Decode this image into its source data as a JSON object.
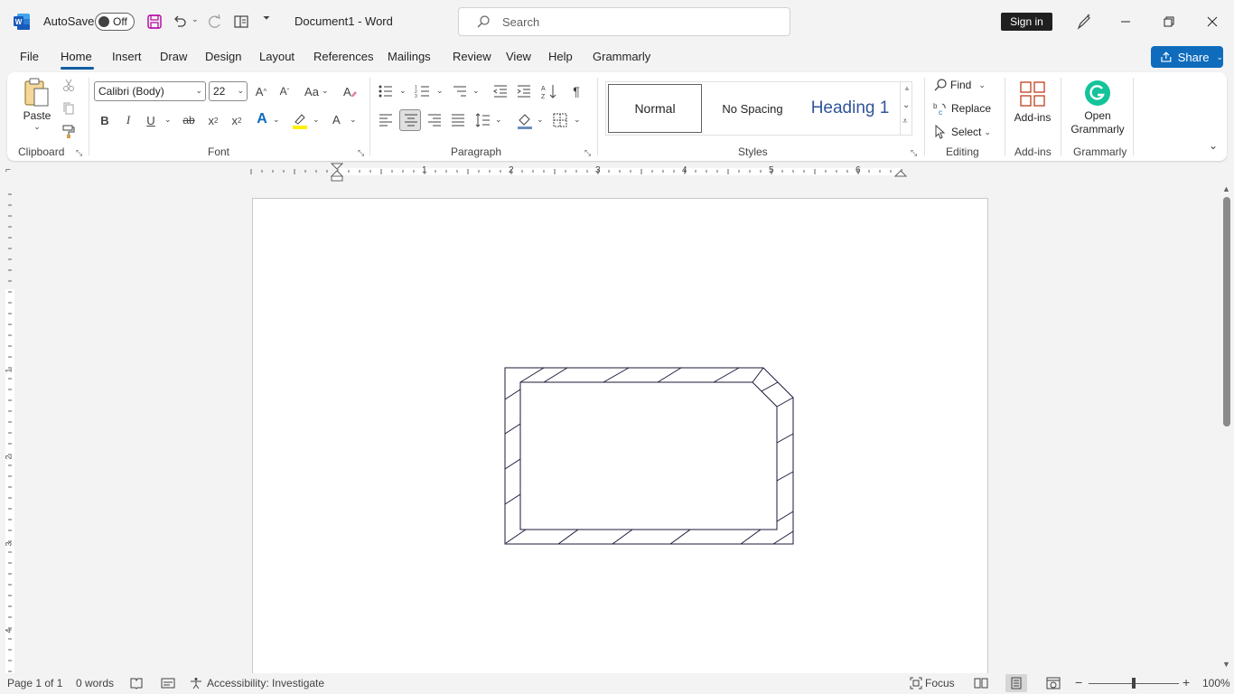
{
  "titlebar": {
    "autosave_label": "AutoSave",
    "autosave_state": "Off",
    "doc_title": "Document1  -  Word",
    "search_placeholder": "Search",
    "signin_label": "Sign in"
  },
  "tabs": [
    "File",
    "Home",
    "Insert",
    "Draw",
    "Design",
    "Layout",
    "References",
    "Mailings",
    "Review",
    "View",
    "Help",
    "Grammarly"
  ],
  "active_tab": "Home",
  "share_label": "Share",
  "ribbon": {
    "clipboard": {
      "paste_label": "Paste",
      "group_label": "Clipboard"
    },
    "font": {
      "font_name": "Calibri (Body)",
      "font_size": "22",
      "group_label": "Font",
      "change_case": "Aa"
    },
    "paragraph": {
      "group_label": "Paragraph"
    },
    "styles": {
      "items": [
        "Normal",
        "No Spacing",
        "Heading 1"
      ],
      "group_label": "Styles"
    },
    "editing": {
      "find": "Find",
      "replace": "Replace",
      "select": "Select",
      "group_label": "Editing"
    },
    "addins": {
      "label": "Add-ins",
      "group_label": "Add-ins"
    },
    "grammarly": {
      "label_line1": "Open",
      "label_line2": "Grammarly",
      "group_label": "Grammarly"
    }
  },
  "ruler_numbers": [
    "1",
    "2",
    "3",
    "4",
    "5",
    "6"
  ],
  "vruler_numbers": [
    "1",
    "2",
    "3",
    "4"
  ],
  "status": {
    "page": "Page 1 of 1",
    "words": "0 words",
    "accessibility": "Accessibility: Investigate",
    "focus": "Focus",
    "zoom": "100%"
  },
  "colors": {
    "accent": "#0f6cbd",
    "word_blue": "#185abd",
    "grammarly_green": "#15c39a",
    "addins_orange": "#c43e1c",
    "heading_blue": "#2f5597"
  }
}
